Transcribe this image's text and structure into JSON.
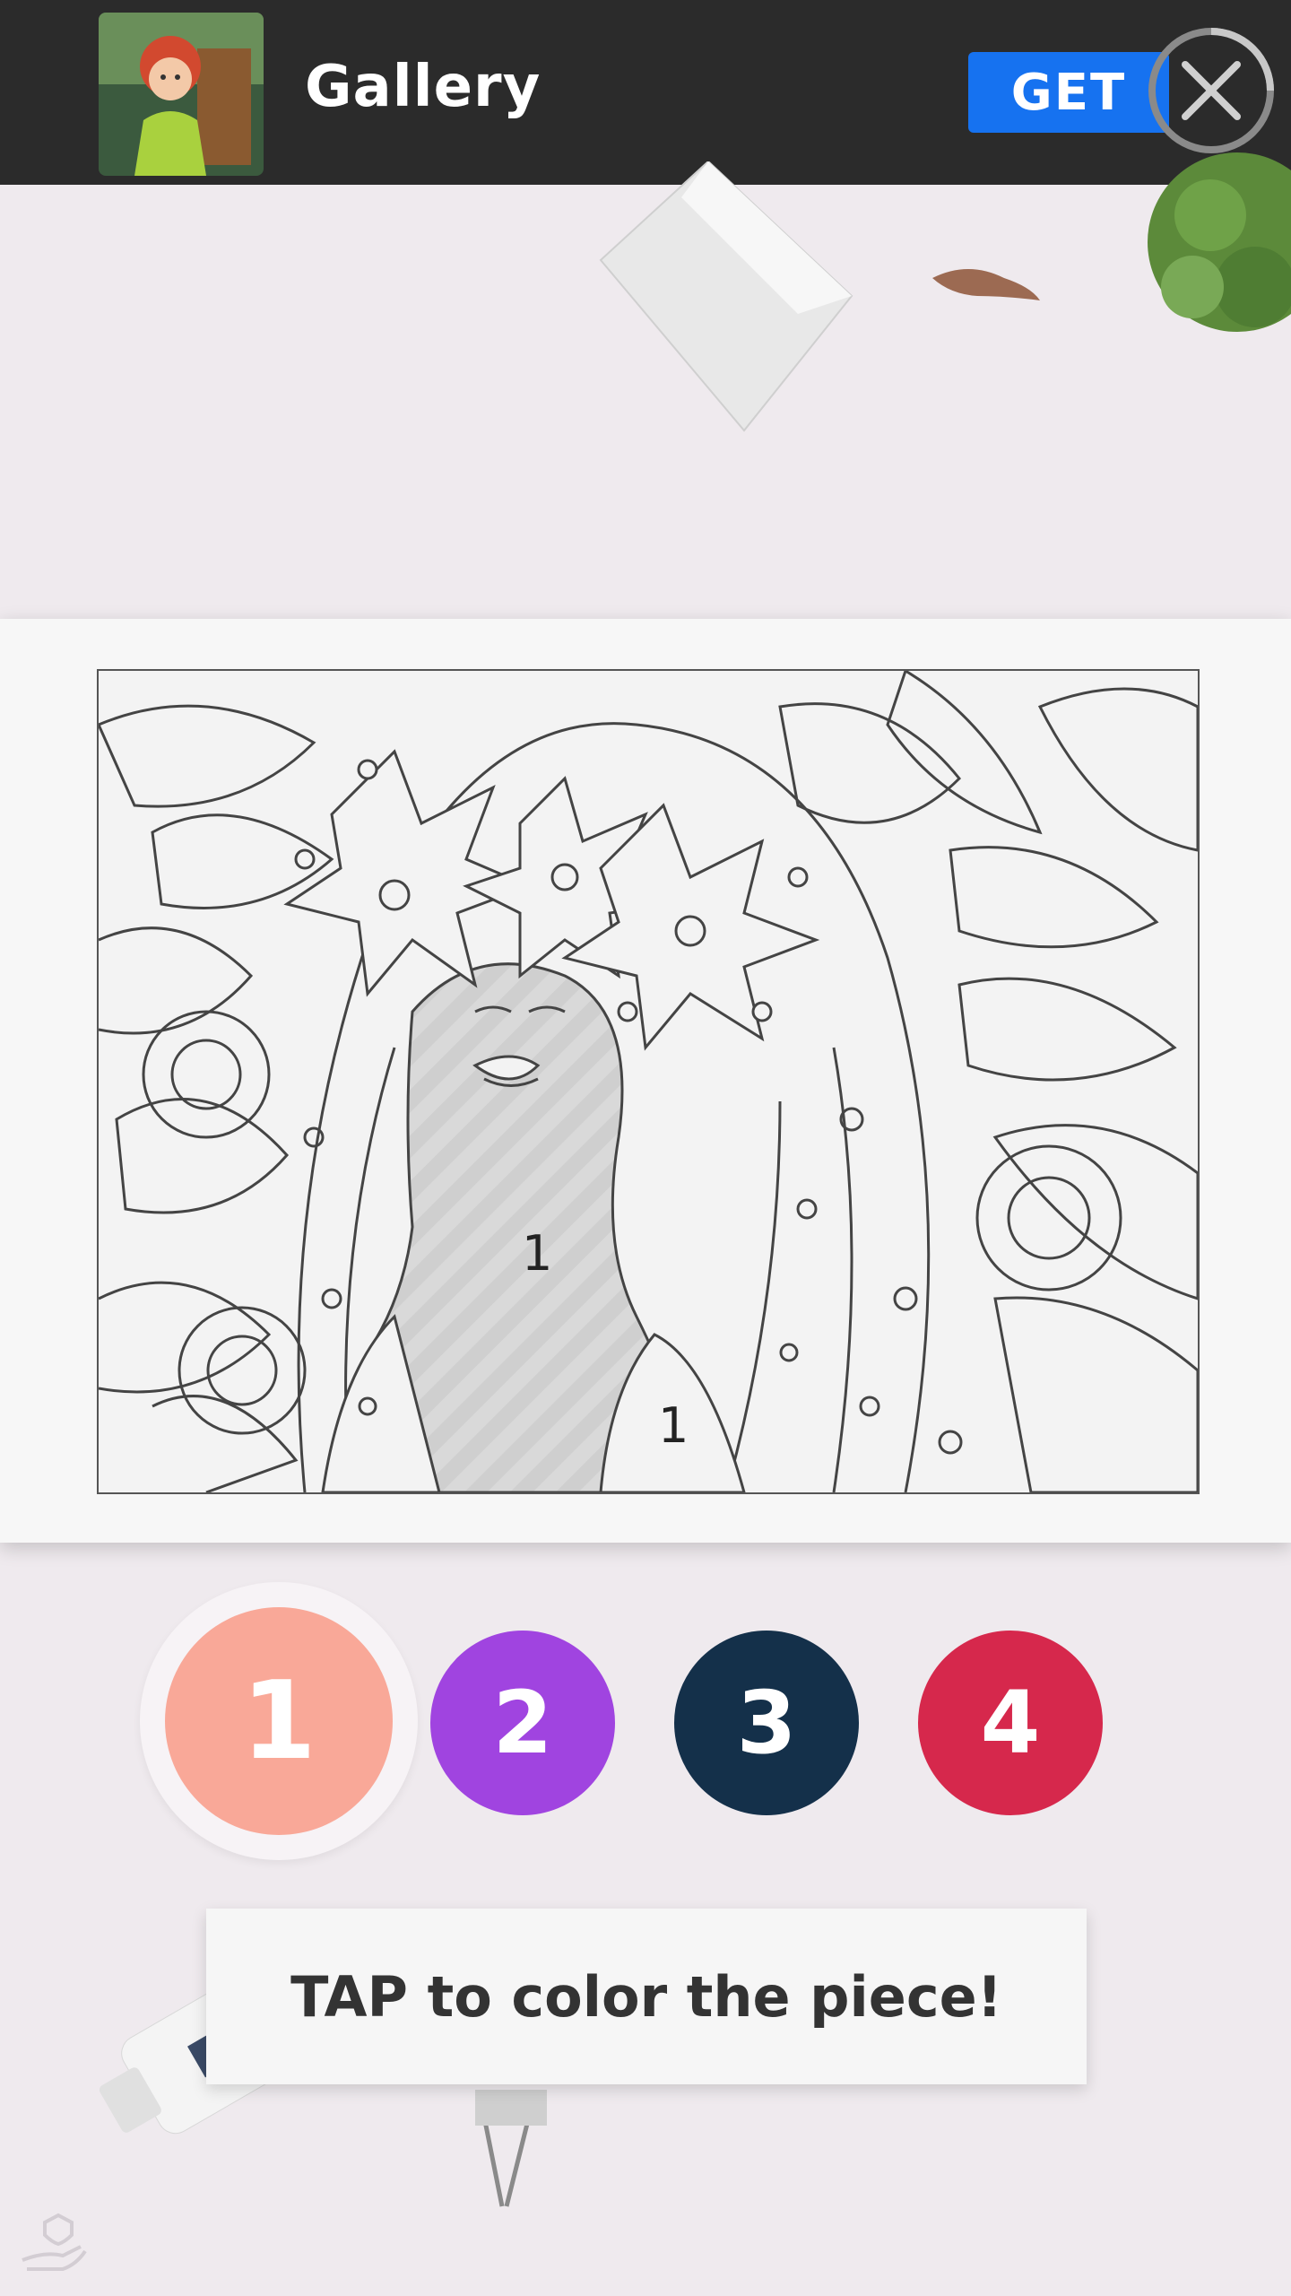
{
  "ad": {
    "app_title": "Gallery",
    "get_label": "GET",
    "icon": "close-icon"
  },
  "artwork": {
    "region_numbers": [
      "1",
      "1"
    ]
  },
  "palette": [
    {
      "number": "1",
      "color": "#f9a898",
      "selected": true
    },
    {
      "number": "2",
      "color": "#a044e0",
      "selected": false
    },
    {
      "number": "3",
      "color": "#14304a",
      "selected": false
    },
    {
      "number": "4",
      "color": "#d6284c",
      "selected": false
    }
  ],
  "hint": "TAP to color the piece!"
}
